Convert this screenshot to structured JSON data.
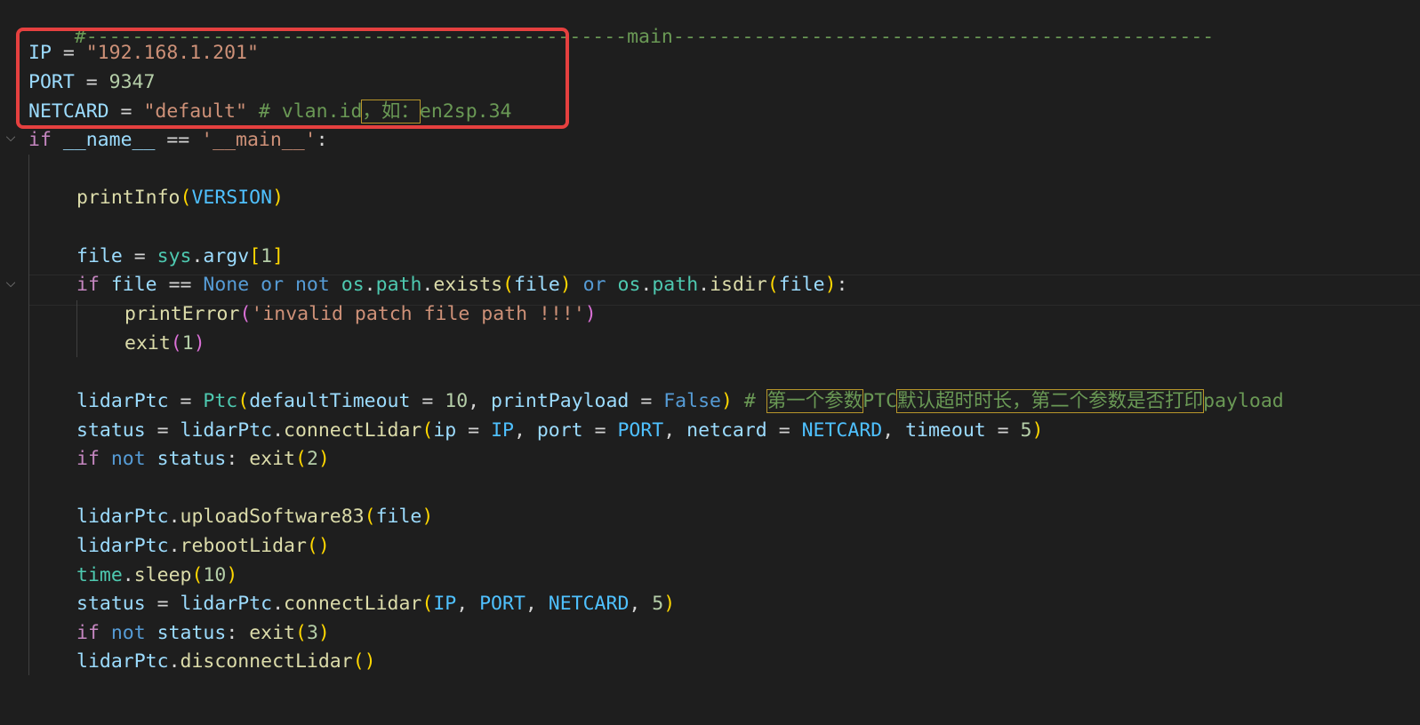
{
  "code": {
    "separator": "#-----------------------------------------------main-----------------------------------------------",
    "ip_var": "IP",
    "ip_value": "\"192.168.1.201\"",
    "port_var": "PORT",
    "port_value": "9347",
    "netcard_var": "NETCARD",
    "netcard_value": "\"default\"",
    "netcard_comment_a": "# vlan.id",
    "netcard_comment_b": "，如：",
    "netcard_comment_c": "en2sp.34",
    "if_main_name": "__name__",
    "if_main_value": "'__main__'",
    "print_info_fn": "printInfo",
    "version_const": "VERSION",
    "file_var": "file",
    "sys_module": "sys",
    "argv_attr": "argv",
    "argv_index": "1",
    "none_kw": "None",
    "os_module": "os",
    "path_attr": "path",
    "exists_fn": "exists",
    "isdir_fn": "isdir",
    "print_error_fn": "printError",
    "error_message": "'invalid patch file path !!!'",
    "exit_fn": "exit",
    "exit_code_1": "1",
    "lidar_var": "lidarPtc",
    "ptc_class": "Ptc",
    "default_timeout_param": "defaultTimeout",
    "default_timeout_value": "10",
    "print_payload_param": "printPayload",
    "false_kw": "False",
    "ptc_comment_hash": "# ",
    "ptc_comment_a": "第一个参数",
    "ptc_comment_b": "PTC",
    "ptc_comment_c": "默认超时时长，第二个参数是否打印",
    "ptc_comment_d": "payload",
    "status_var": "status",
    "connect_fn": "connectLidar",
    "ip_param": "ip",
    "port_param": "port",
    "netcard_param": "netcard",
    "timeout_param": "timeout",
    "timeout_value": "5",
    "exit_code_2": "2",
    "upload_fn": "uploadSoftware83",
    "reboot_fn": "rebootLidar",
    "time_module": "time",
    "sleep_fn": "sleep",
    "sleep_value": "10",
    "exit_code_3": "3",
    "disconnect_fn": "disconnectLidar"
  },
  "keywords": {
    "if": "if",
    "or": "or",
    "not": "not"
  },
  "icons": {
    "fold_open": "chevron-down-icon"
  },
  "colors": {
    "highlight_box": "#e5403f",
    "background": "#1e1e1e"
  }
}
